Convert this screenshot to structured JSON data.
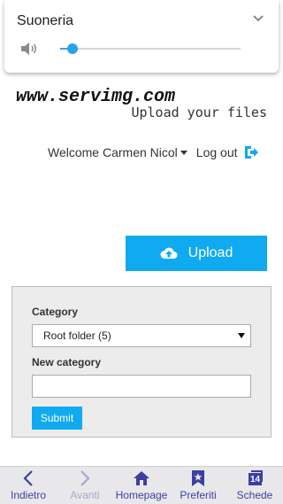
{
  "volume": {
    "title": "Suoneria",
    "level_percent": 7,
    "accent_color": "#29a3e8",
    "icons": [
      "speaker-icon",
      "chevron-down-icon"
    ]
  },
  "logo": {
    "main_text": "www.servimg.com",
    "tagline": "Upload your files"
  },
  "user": {
    "welcome_text": "Welcome Carmen Nicol",
    "logout_label": "Log out",
    "logout_icon": "logout-icon"
  },
  "upload": {
    "label": "Upload",
    "icon": "cloud-upload-icon",
    "color": "#10aaf0"
  },
  "form": {
    "category_label": "Category",
    "category_selected": "Root folder (5)",
    "new_category_label": "New category",
    "new_category_value": "",
    "submit_label": "Submit"
  },
  "bottom_nav": {
    "items": [
      {
        "label": "Indietro",
        "icon": "back-arrow-icon",
        "enabled": true
      },
      {
        "label": "Avanti",
        "icon": "forward-arrow-icon",
        "enabled": false
      },
      {
        "label": "Homepage",
        "icon": "home-icon",
        "enabled": true
      },
      {
        "label": "Preferiti",
        "icon": "bookmark-star-icon",
        "enabled": true
      },
      {
        "label": "Schede",
        "icon": "tabs-icon",
        "enabled": true,
        "count": "14"
      }
    ],
    "color": "#3b3fa3"
  }
}
